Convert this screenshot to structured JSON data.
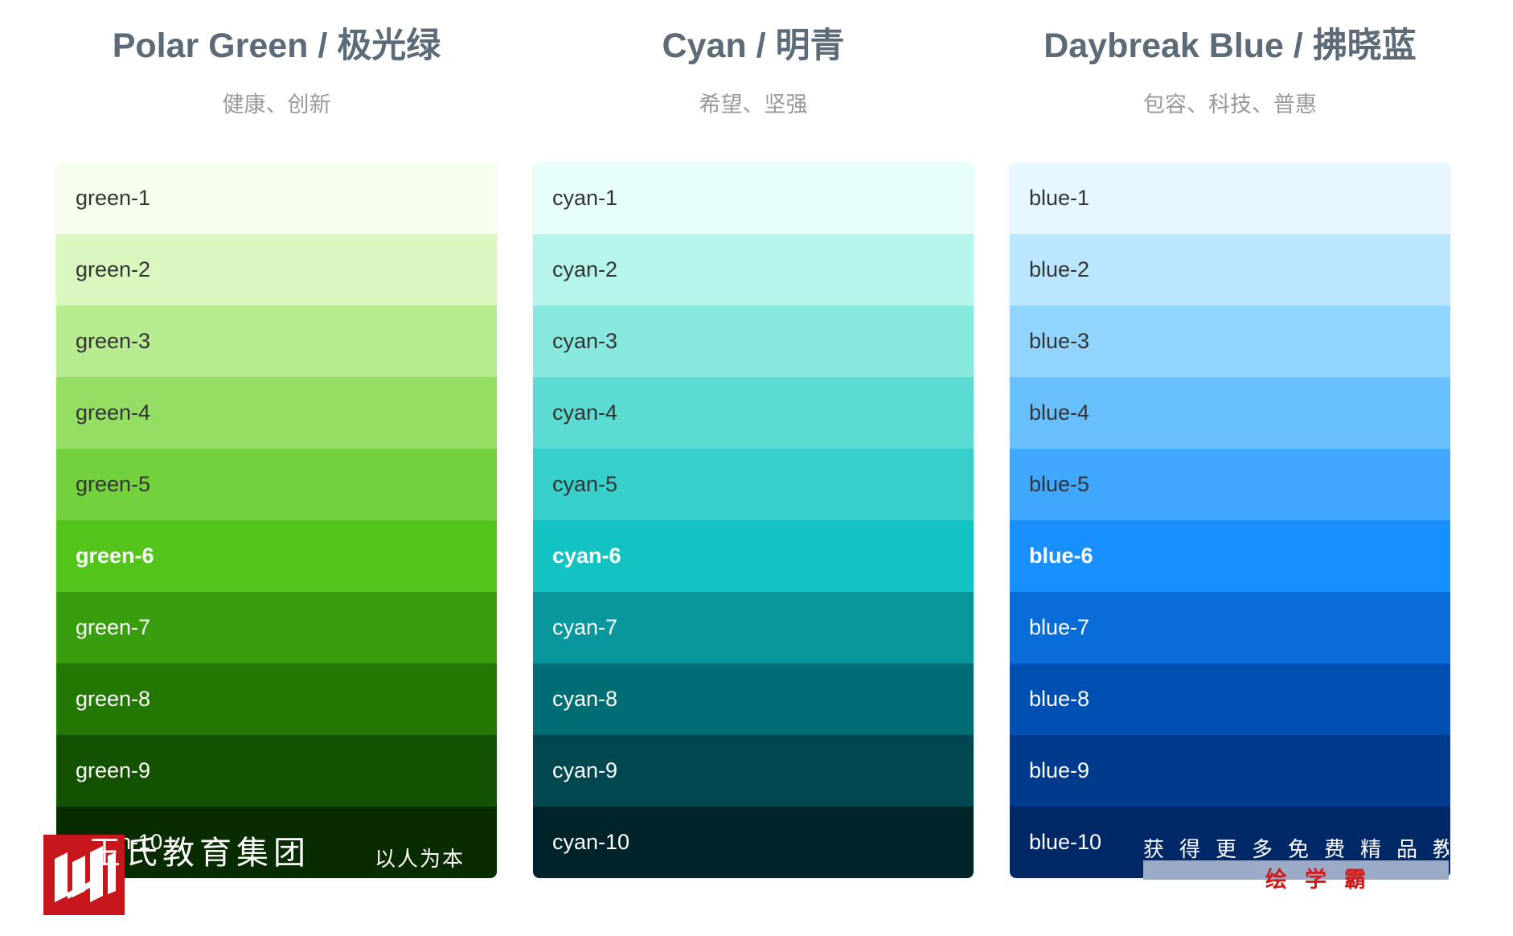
{
  "palettes": [
    {
      "title": "Polar Green / 极光绿",
      "subtitle": "健康、创新",
      "swatches": [
        {
          "label": "green-1",
          "color": "#f6ffed",
          "text": "light"
        },
        {
          "label": "green-2",
          "color": "#d9f7be",
          "text": "light"
        },
        {
          "label": "green-3",
          "color": "#b7eb8f",
          "text": "light"
        },
        {
          "label": "green-4",
          "color": "#95de64",
          "text": "light"
        },
        {
          "label": "green-5",
          "color": "#73d13d",
          "text": "light"
        },
        {
          "label": "green-6",
          "color": "#52c41a",
          "text": "dark",
          "primary": true
        },
        {
          "label": "green-7",
          "color": "#389e0d",
          "text": "dark"
        },
        {
          "label": "green-8",
          "color": "#237804",
          "text": "dark"
        },
        {
          "label": "green-9",
          "color": "#135200",
          "text": "dark"
        },
        {
          "label": "green-10",
          "color": "#092b00",
          "text": "dark"
        }
      ]
    },
    {
      "title": "Cyan / 明青",
      "subtitle": "希望、坚强",
      "swatches": [
        {
          "label": "cyan-1",
          "color": "#e6fffb",
          "text": "light"
        },
        {
          "label": "cyan-2",
          "color": "#b5f5ec",
          "text": "light"
        },
        {
          "label": "cyan-3",
          "color": "#87e8de",
          "text": "light"
        },
        {
          "label": "cyan-4",
          "color": "#5cdbd3",
          "text": "light"
        },
        {
          "label": "cyan-5",
          "color": "#36cfc9",
          "text": "light"
        },
        {
          "label": "cyan-6",
          "color": "#13c2c2",
          "text": "dark",
          "primary": true
        },
        {
          "label": "cyan-7",
          "color": "#08979c",
          "text": "dark"
        },
        {
          "label": "cyan-8",
          "color": "#006d75",
          "text": "dark"
        },
        {
          "label": "cyan-9",
          "color": "#00474f",
          "text": "dark"
        },
        {
          "label": "cyan-10",
          "color": "#002329",
          "text": "dark"
        }
      ]
    },
    {
      "title": "Daybreak Blue / 拂晓蓝",
      "subtitle": "包容、科技、普惠",
      "swatches": [
        {
          "label": "blue-1",
          "color": "#e6f7ff",
          "text": "light"
        },
        {
          "label": "blue-2",
          "color": "#bae7ff",
          "text": "light"
        },
        {
          "label": "blue-3",
          "color": "#91d5ff",
          "text": "light"
        },
        {
          "label": "blue-4",
          "color": "#69c0ff",
          "text": "light"
        },
        {
          "label": "blue-5",
          "color": "#40a9ff",
          "text": "light"
        },
        {
          "label": "blue-6",
          "color": "#1890ff",
          "text": "dark",
          "primary": true
        },
        {
          "label": "blue-7",
          "color": "#096dd9",
          "text": "dark"
        },
        {
          "label": "blue-8",
          "color": "#0050b3",
          "text": "dark"
        },
        {
          "label": "blue-9",
          "color": "#003a8c",
          "text": "dark"
        },
        {
          "label": "blue-10",
          "color": "#002766",
          "text": "dark"
        }
      ]
    }
  ],
  "watermark": {
    "left_name": "王氏教育集团",
    "left_motto": "以人为本",
    "right_top": "获得更多免费精品教",
    "right_bottom": "绘学霸"
  }
}
